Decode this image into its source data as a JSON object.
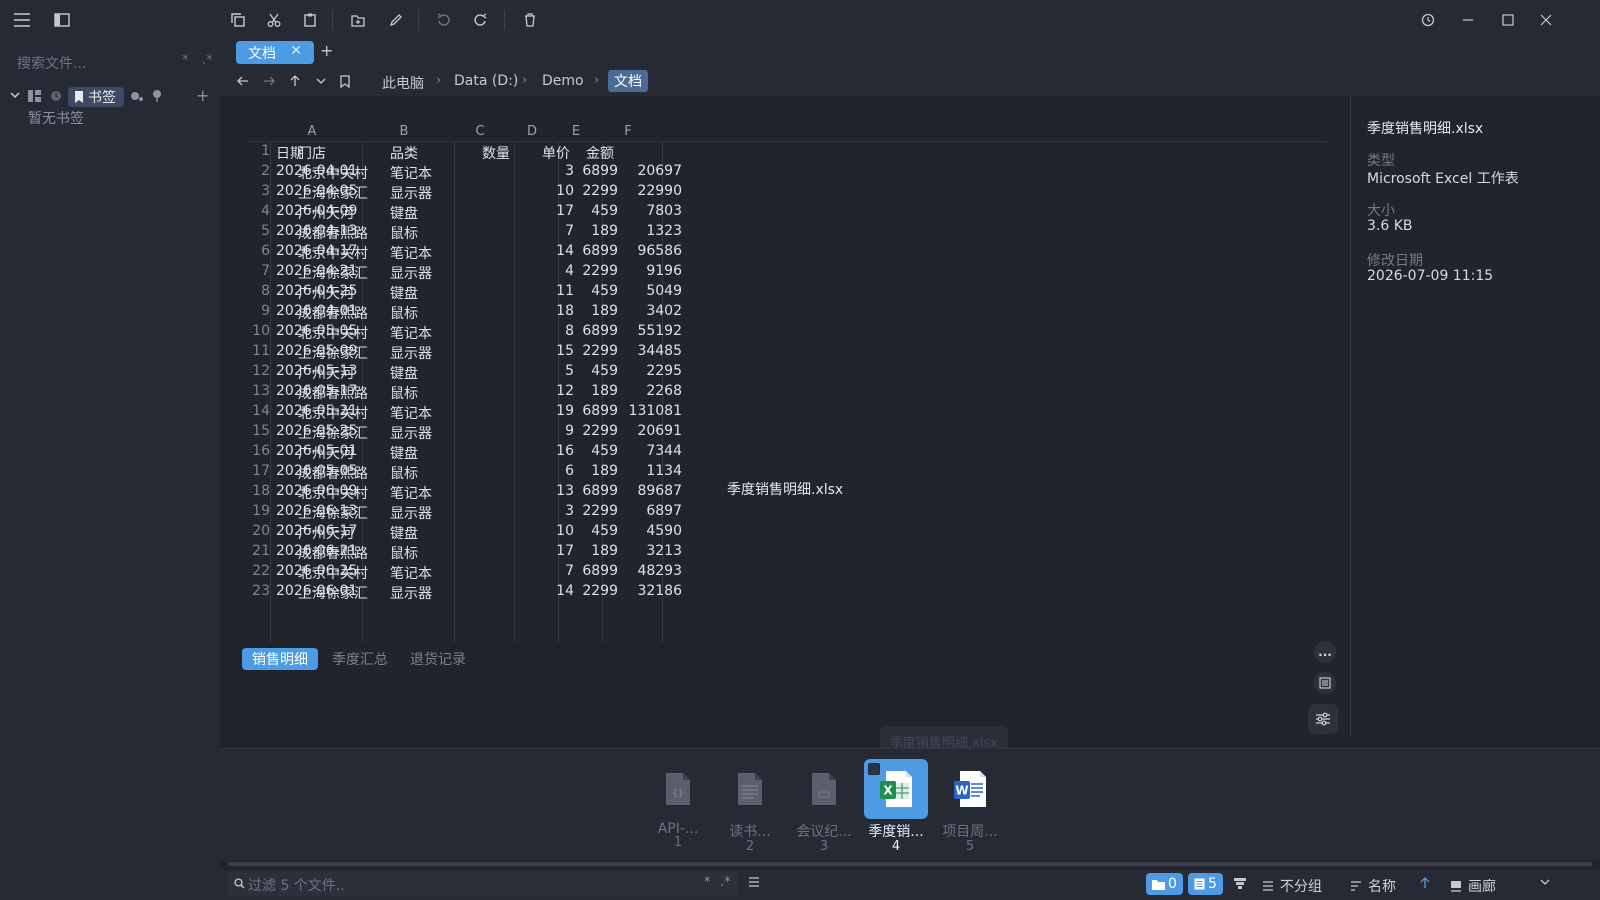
{
  "sidebar": {
    "search_placeholder": "搜索文件...",
    "search_opt_star": "*",
    "search_opt_regex": ".*",
    "bookmark_label": "书签",
    "no_bookmarks": "暂无书签"
  },
  "tabs": [
    {
      "label": "文档",
      "close": "✕"
    }
  ],
  "tab_add": "+",
  "breadcrumb": [
    "此电脑",
    "Data (D:)",
    "Demo",
    "文档"
  ],
  "breadcrumb_sep": "›",
  "sheet": {
    "columns": [
      "A",
      "B",
      "C",
      "D",
      "E",
      "F"
    ],
    "rows": [
      [
        "日期",
        "门店",
        "品类",
        "数量",
        "单价",
        "金额"
      ],
      [
        "2026-04-01",
        "北京中关村",
        "笔记本",
        "3",
        "6899",
        "20697"
      ],
      [
        "2026-04-05",
        "上海徐家汇",
        "显示器",
        "10",
        "2299",
        "22990"
      ],
      [
        "2026-04-09",
        "广州天河",
        "键盘",
        "17",
        "459",
        "7803"
      ],
      [
        "2026-04-13",
        "成都春熙路",
        "鼠标",
        "7",
        "189",
        "1323"
      ],
      [
        "2026-04-17",
        "北京中关村",
        "笔记本",
        "14",
        "6899",
        "96586"
      ],
      [
        "2026-04-21",
        "上海徐家汇",
        "显示器",
        "4",
        "2299",
        "9196"
      ],
      [
        "2026-04-25",
        "广州天河",
        "键盘",
        "11",
        "459",
        "5049"
      ],
      [
        "2026-04-01",
        "成都春熙路",
        "鼠标",
        "18",
        "189",
        "3402"
      ],
      [
        "2026-05-05",
        "北京中关村",
        "笔记本",
        "8",
        "6899",
        "55192"
      ],
      [
        "2026-05-09",
        "上海徐家汇",
        "显示器",
        "15",
        "2299",
        "34485"
      ],
      [
        "2026-05-13",
        "广州天河",
        "键盘",
        "5",
        "459",
        "2295"
      ],
      [
        "2026-05-17",
        "成都春熙路",
        "鼠标",
        "12",
        "189",
        "2268"
      ],
      [
        "2026-05-21",
        "北京中关村",
        "笔记本",
        "19",
        "6899",
        "131081"
      ],
      [
        "2026-05-25",
        "上海徐家汇",
        "显示器",
        "9",
        "2299",
        "20691"
      ],
      [
        "2026-05-01",
        "广州天河",
        "键盘",
        "16",
        "459",
        "7344"
      ],
      [
        "2026-05-05",
        "成都春熙路",
        "鼠标",
        "6",
        "189",
        "1134"
      ],
      [
        "2026-06-09",
        "北京中关村",
        "笔记本",
        "13",
        "6899",
        "89687"
      ],
      [
        "2026-06-13",
        "上海徐家汇",
        "显示器",
        "3",
        "2299",
        "6897"
      ],
      [
        "2026-06-17",
        "广州天河",
        "键盘",
        "10",
        "459",
        "4590"
      ],
      [
        "2026-06-21",
        "成都春熙路",
        "鼠标",
        "17",
        "189",
        "3213"
      ],
      [
        "2026-06-25",
        "北京中关村",
        "笔记本",
        "7",
        "6899",
        "48293"
      ],
      [
        "2026-06-01",
        "上海徐家汇",
        "显示器",
        "14",
        "2299",
        "32186"
      ]
    ],
    "sheet_tabs": [
      "销售明细",
      "季度汇总",
      "退货记录"
    ]
  },
  "preview_filename": "季度销售明细.xlsx",
  "info": {
    "title": "季度销售明细.xlsx",
    "type_label": "类型",
    "type_value": "Microsoft Excel 工作表",
    "size_label": "大小",
    "size_value": "3.6 KB",
    "modified_label": "修改日期",
    "modified_value": "2026-07-09 11:15"
  },
  "side_more": "...",
  "gallery": {
    "tooltip": "季度销售明细.xlsx",
    "items": [
      {
        "name": "API-...",
        "index": "1",
        "icon": "json-file-icon"
      },
      {
        "name": "读书...",
        "index": "2",
        "icon": "text-file-icon"
      },
      {
        "name": "会议纪...",
        "index": "3",
        "icon": "document-file-icon"
      },
      {
        "name": "季度销...",
        "index": "4",
        "icon": "excel-file-icon"
      },
      {
        "name": "项目周...",
        "index": "5",
        "icon": "word-file-icon"
      }
    ]
  },
  "status": {
    "filter_placeholder": "过滤 5 个文件..",
    "filter_opt_star": "*",
    "filter_opt_regex": ".*",
    "folder_count": "0",
    "file_count": "5",
    "group_label": "不分组",
    "sort_label": "名称",
    "view_label": "画廊"
  },
  "colors": {
    "accent": "#4c9be3",
    "bg": "#21242d",
    "panel": "#262a35"
  }
}
